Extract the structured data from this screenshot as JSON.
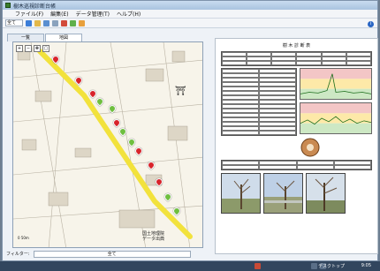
{
  "window": {
    "title": "樹木巡視診断台帳"
  },
  "menu": [
    "ファイル(F)",
    "編集(E)",
    "データ管理(T)",
    "ヘルプ(H)"
  ],
  "toolbar": {
    "scope_value": "全て",
    "info_icon": "info-icon"
  },
  "tabs": [
    {
      "label": "一覧"
    },
    {
      "label": "地図"
    }
  ],
  "map": {
    "scale_label": "0      50m",
    "credit_line1": "国土地理院",
    "credit_line2": "データ出典",
    "tools": [
      "zoom-in-icon",
      "zoom-out-icon",
      "pan-icon",
      "select-icon"
    ],
    "markers": [
      {
        "kind": "red",
        "label": ""
      },
      {
        "kind": "red",
        "label": ""
      },
      {
        "kind": "red",
        "label": ""
      },
      {
        "kind": "green",
        "label": ""
      },
      {
        "kind": "green",
        "label": ""
      },
      {
        "kind": "red",
        "label": ""
      },
      {
        "kind": "green",
        "label": ""
      },
      {
        "kind": "green",
        "label": ""
      },
      {
        "kind": "red",
        "label": ""
      },
      {
        "kind": "red",
        "label": ""
      },
      {
        "kind": "red",
        "label": ""
      },
      {
        "kind": "green",
        "label": ""
      },
      {
        "kind": "green",
        "label": ""
      }
    ]
  },
  "filter": {
    "label": "フィルター:",
    "value": "全て"
  },
  "document": {
    "title": "樹 木 診 断 表"
  },
  "taskbar": {
    "clock": "9:05",
    "desktop_label": "デスクトップ"
  },
  "colors": {
    "red_marker": "#d8242b",
    "green_marker": "#6fbf3f",
    "route": "#f2e23c"
  }
}
